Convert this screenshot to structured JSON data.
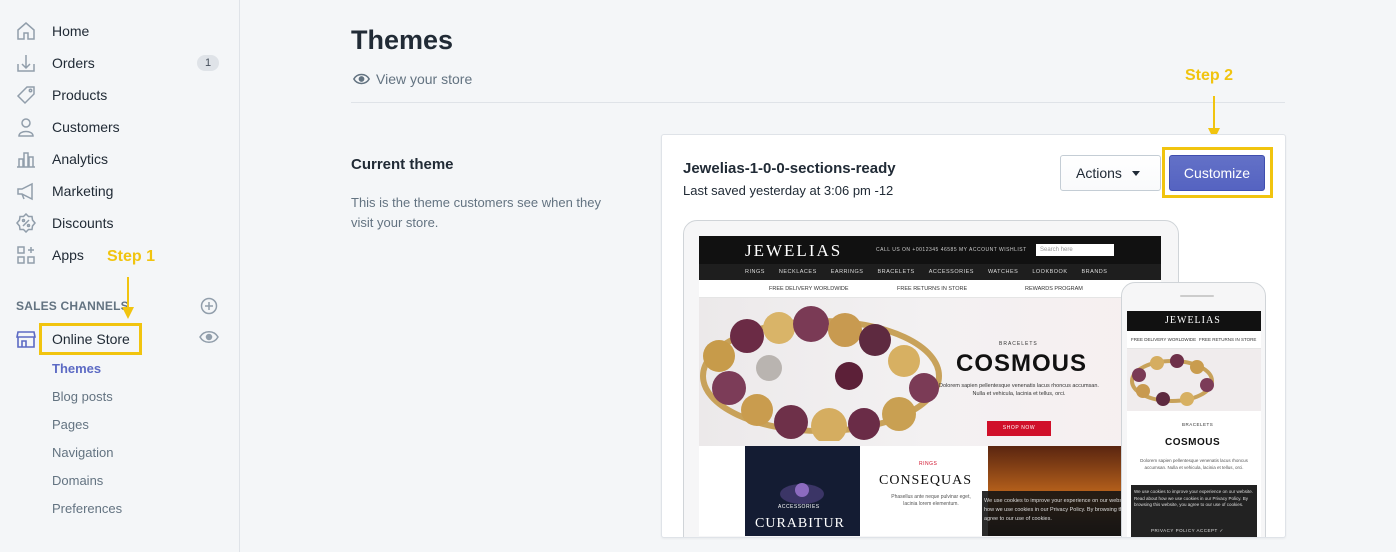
{
  "sidebar": {
    "items": [
      {
        "label": "Home",
        "icon": "home-icon"
      },
      {
        "label": "Orders",
        "icon": "orders-icon",
        "badge": "1"
      },
      {
        "label": "Products",
        "icon": "tag-icon"
      },
      {
        "label": "Customers",
        "icon": "person-icon"
      },
      {
        "label": "Analytics",
        "icon": "bar-chart-icon"
      },
      {
        "label": "Marketing",
        "icon": "megaphone-icon"
      },
      {
        "label": "Discounts",
        "icon": "discount-icon"
      },
      {
        "label": "Apps",
        "icon": "apps-icon"
      }
    ],
    "sales_channels_heading": "SALES CHANNELS",
    "online_store": "Online Store",
    "sub_items": [
      "Themes",
      "Blog posts",
      "Pages",
      "Navigation",
      "Domains",
      "Preferences"
    ]
  },
  "annotations": {
    "step1": "Step 1",
    "step2": "Step 2",
    "color": "#f1c40f"
  },
  "main": {
    "title": "Themes",
    "view_store": "View your store",
    "current_theme_heading": "Current theme",
    "current_theme_desc": "This is the theme customers see when they visit your store.",
    "theme_name": "Jewelias-1-0-0-sections-ready",
    "last_saved": "Last saved yesterday at 3:06 pm -12",
    "actions_label": "Actions",
    "customize_label": "Customize",
    "accent_color": "#5c6ac4"
  },
  "preview": {
    "logo": "JEWELIAS",
    "search_placeholder": "Search here",
    "top_links": "CALL US ON +0012345 46585     MY ACCOUNT     WISHLIST",
    "nav": [
      "RINGS",
      "NECKLACES",
      "EARRINGS",
      "BRACELETS",
      "ACCESSORIES",
      "WATCHES",
      "LOOKBOOK",
      "BRANDS"
    ],
    "strip": [
      "FREE DELIVERY WORLDWIDE",
      "FREE RETURNS IN STORE",
      "REWARDS PROGRAM"
    ],
    "hero_tag": "BRACELETS",
    "hero_title": "COSMOUS",
    "hero_copy": "Dolorem sapien pellentesque venenatis lacus rhoncus accumsan. Nulla et vehicula, lacinia et tellus, orci.",
    "hero_button": "SHOP NOW",
    "tile1_tag": "ACCESSORIES",
    "tile1_name": "CURABITUR",
    "tile2_tag": "RINGS",
    "tile2_name": "CONSEQUAS",
    "tile2_copy": "Phasellus ante neque pulvinar eget, lacinia lorem elementum.",
    "cookie_text": "We use cookies to improve your experience on our website. Read about how we use cookies in our Privacy Policy. By browsing this website, you agree to our use of cookies.",
    "phone_strip": [
      "FREE DELIVERY WORLDWIDE",
      "FREE RETURNS IN STORE"
    ],
    "phone_cookie_buttons": "PRIVACY POLICY    ACCEPT ✓"
  }
}
